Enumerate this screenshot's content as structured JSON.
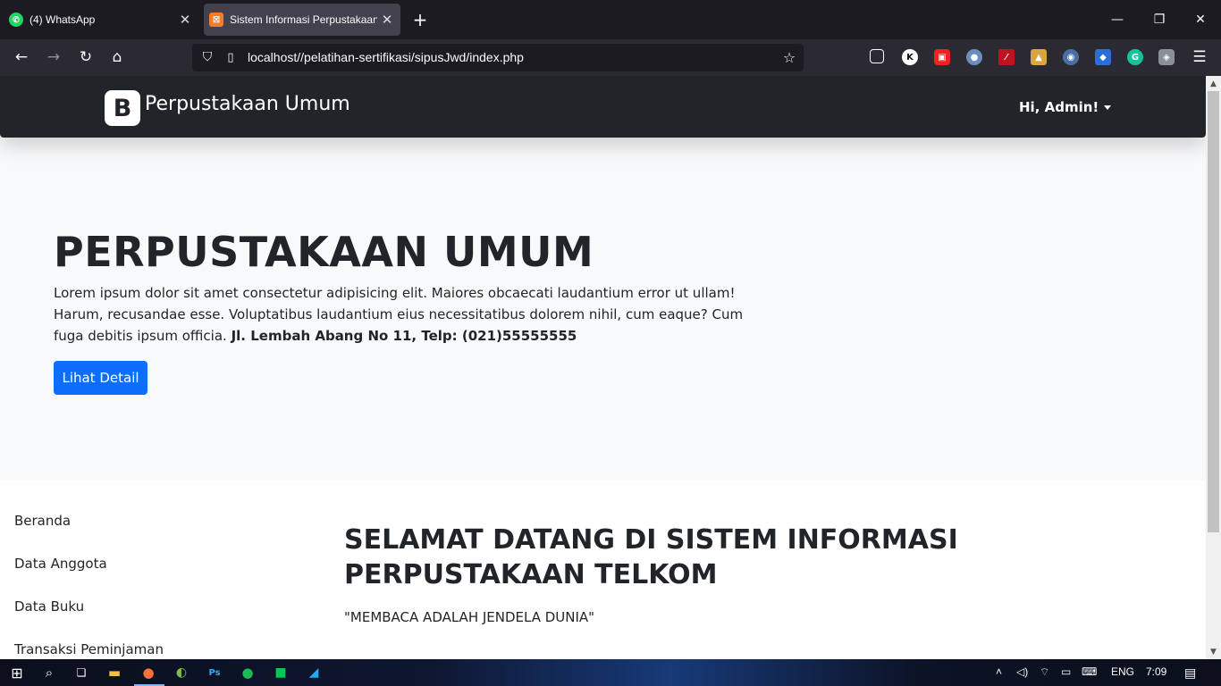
{
  "browser": {
    "tabs": [
      {
        "title": "(4) WhatsApp",
        "favicon": "whatsapp-icon",
        "active": false
      },
      {
        "title": "Sistem Informasi Perpustakaan",
        "favicon": "xampp-icon",
        "active": true
      }
    ],
    "url": "localhost//pelatihan-sertifikasi/sipusJwd/index.php"
  },
  "site": {
    "brand_logo_letter": "B",
    "brand_name": "Perpustakaan Umum",
    "user_menu_label": "Hi, Admin!"
  },
  "hero": {
    "title": "PERPUSTAKAAN UMUM",
    "text": "Lorem ipsum dolor sit amet consectetur adipisicing elit. Maiores obcaecati laudantium error ut ullam! Harum, recusandae esse. Voluptatibus laudantium eius necessitatibus dolorem nihil, cum eaque? Cum fuga debitis ipsum officia.",
    "address": "Jl. Lembah Abang No 11, Telp: (021)55555555",
    "button_label": "Lihat Detail"
  },
  "sidebar": {
    "items": [
      "Beranda",
      "Data Anggota",
      "Data Buku",
      "Transaksi Peminjaman"
    ]
  },
  "main": {
    "title": "SELAMAT DATANG DI SISTEM INFORMASI PERPUSTAKAAN TELKOM",
    "quote": "\"MEMBACA ADALAH JENDELA DUNIA\""
  },
  "taskbar": {
    "language": "ENG",
    "time": "7:09"
  },
  "colors": {
    "navbar_bg": "#212529",
    "hero_bg": "#f8f9fa",
    "primary_button": "#0d6efd"
  }
}
